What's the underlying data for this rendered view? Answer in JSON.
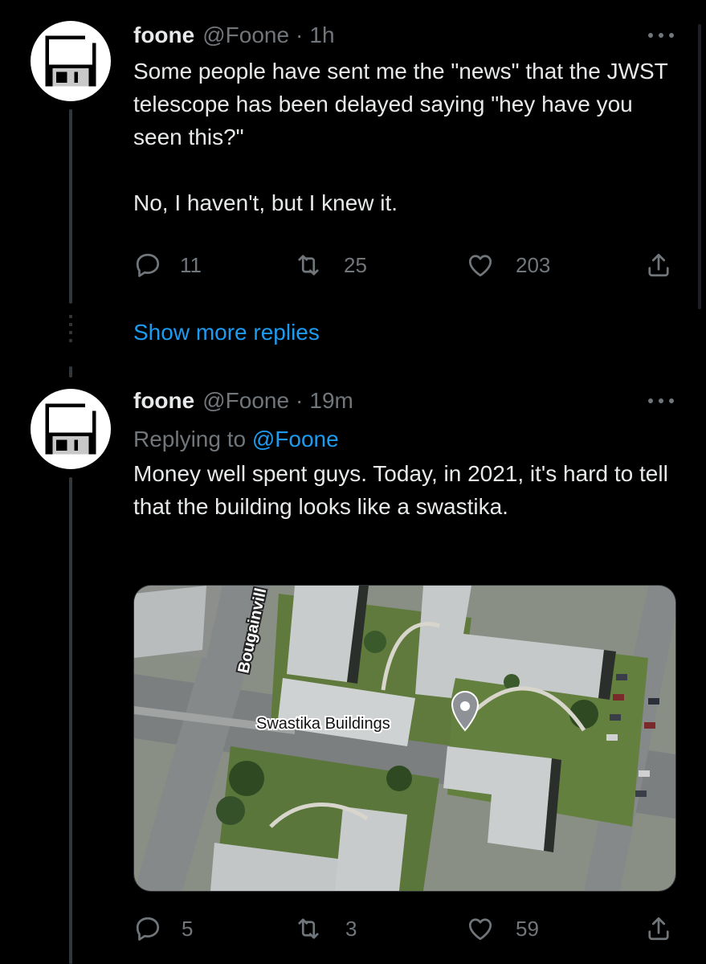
{
  "tweet1": {
    "name": "foone",
    "handle": "@Foone",
    "separator": "·",
    "time": "1h",
    "text": "Some people have sent me the \"news\" that the JWST telescope has been delayed saying \"hey have you seen this?\"\n\nNo, I haven't, but I knew it.",
    "replies": "11",
    "retweets": "25",
    "likes": "203"
  },
  "show_more_label": "Show more replies",
  "tweet2": {
    "name": "foone",
    "handle": "@Foone",
    "separator": "·",
    "time": "19m",
    "replying_prefix": "Replying to ",
    "replying_to": "@Foone",
    "text": "Money well spent guys. Today, in 2021, it's hard to tell that the building looks like a swastika.",
    "replies": "5",
    "retweets": "3",
    "likes": "59",
    "map": {
      "place_label": "Swastika Buildings",
      "street_label": "Bougainvill"
    }
  },
  "icons": {
    "reply": "reply-icon",
    "retweet": "retweet-icon",
    "like": "heart-icon",
    "share": "share-icon",
    "more": "more-icon",
    "avatar": "floppy-disk-icon",
    "pin": "map-pin-icon"
  },
  "colors": {
    "background": "#000000",
    "text": "#e7e9ea",
    "secondary": "#71767b",
    "link": "#1d9bf0"
  }
}
